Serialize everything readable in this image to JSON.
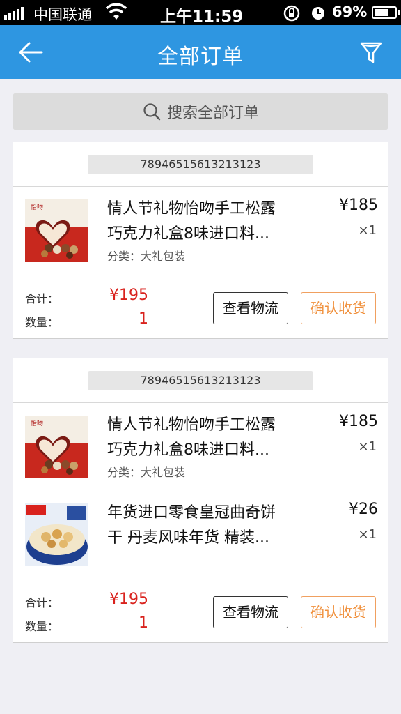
{
  "status_bar": {
    "carrier": "中国联通",
    "time": "上午11:59",
    "battery_percent": "69%",
    "battery_level": 0.69,
    "icons": [
      "signal-icon",
      "wifi-icon",
      "rotation-lock-icon",
      "alarm-icon",
      "battery-icon"
    ]
  },
  "nav": {
    "title": "全部订单",
    "back_icon": "back-arrow-icon",
    "filter_icon": "filter-icon"
  },
  "search": {
    "icon": "search-icon",
    "placeholder": "搜索全部订单"
  },
  "orders": [
    {
      "order_no": "78946515613213123",
      "items": [
        {
          "name_line1": "情人节礼物怡吻手工松露",
          "name_line2": "巧克力礼盒8味进口料...",
          "category": "分类：大礼包装",
          "price": "¥185",
          "qty": "×1"
        }
      ],
      "total_label": "合计：",
      "total": "¥195",
      "count_label": "数量：",
      "count": "1",
      "btn_logistics": "查看物流",
      "btn_confirm": "确认收货"
    },
    {
      "order_no": "78946515613213123",
      "items": [
        {
          "name_line1": "情人节礼物怡吻手工松露",
          "name_line2": "巧克力礼盒8味进口料...",
          "category": "分类：大礼包装",
          "price": "¥185",
          "qty": "×1"
        },
        {
          "name_line1": "年货进口零食皇冠曲奇饼",
          "name_line2": "干 丹麦风味年货 精装...",
          "category": "",
          "price": "¥26",
          "qty": "×1"
        }
      ],
      "total_label": "合计：",
      "total": "¥195",
      "count_label": "数量：",
      "count": "1",
      "btn_logistics": "查看物流",
      "btn_confirm": "确认收货"
    }
  ],
  "colors": {
    "nav_bg": "#2e96e1",
    "price_red": "#d9221d",
    "confirm_orange": "#f0903c",
    "page_bg": "#efeff4"
  }
}
